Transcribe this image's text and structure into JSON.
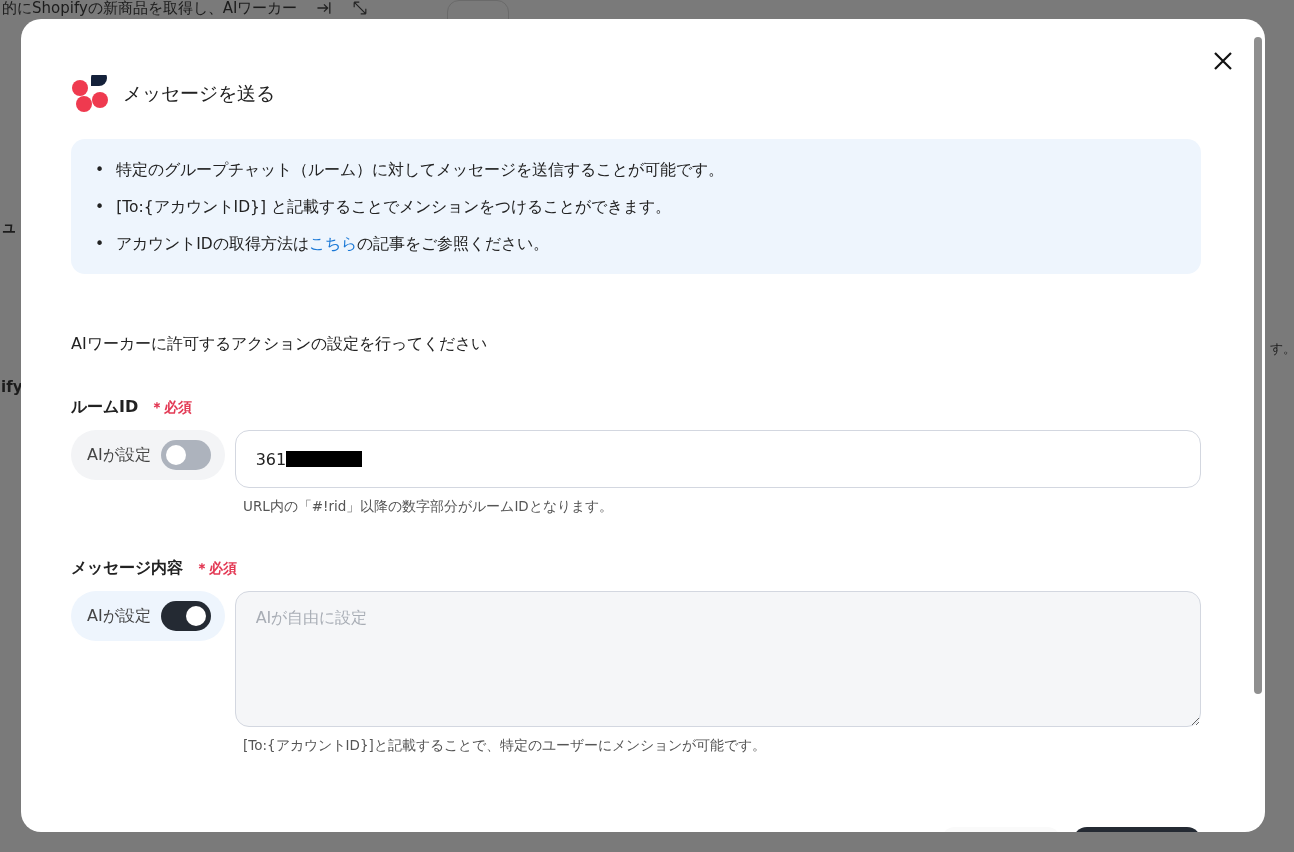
{
  "backdrop": {
    "title": "的にShopifyの新商品を取得し、AIワーカー",
    "left_fragments": [
      "ュ",
      "ify"
    ],
    "right_fragments": [
      "す。"
    ]
  },
  "modal": {
    "title": "メッセージを送る",
    "notes": [
      {
        "bullet": "•",
        "text": "特定のグループチャット（ルーム）に対してメッセージを送信することが可能です。"
      },
      {
        "bullet": "•",
        "text": "[To:{アカウントID}] と記載することでメンションをつけることができます。"
      },
      {
        "bullet": "•",
        "before": "アカウントIDの取得方法は",
        "link": "こちら",
        "after": "の記事をご参照ください。"
      }
    ],
    "intro": "AIワーカーに許可するアクションの設定を行ってください",
    "fields": [
      {
        "kind": "input",
        "label": "ルームID",
        "required": "＊必須",
        "toggle_label": "AIが設定",
        "on": false,
        "value": "361",
        "redacted": true,
        "hint": "URL内の「#!rid」以降の数字部分がルームIDとなります。"
      },
      {
        "kind": "textarea",
        "label": "メッセージ内容",
        "required": "＊必須",
        "toggle_label": "AIが設定",
        "on": true,
        "placeholder": "AIが自由に設定",
        "hint": "[To:{アカウントID}]と記載することで、特定のユーザーにメンションが可能です。"
      }
    ]
  }
}
